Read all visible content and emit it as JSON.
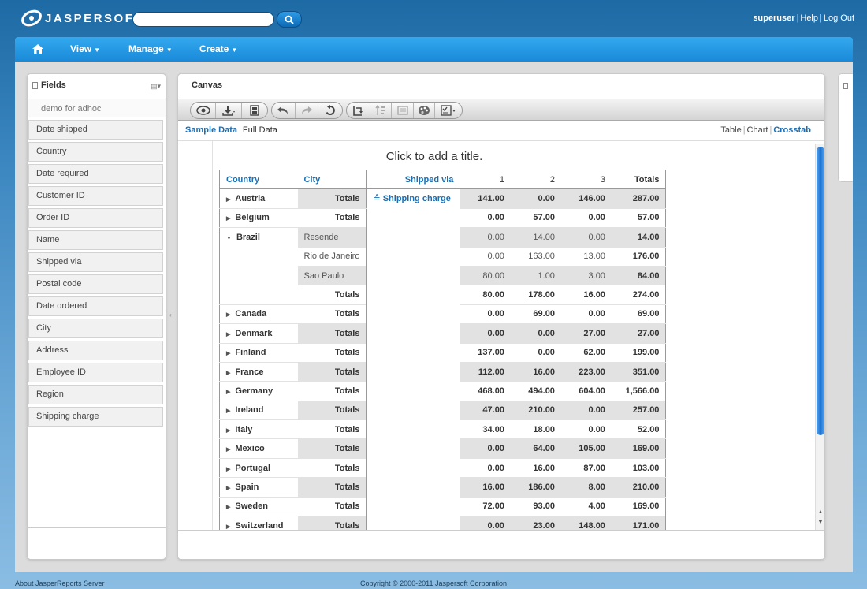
{
  "app": {
    "logo_text": "JASPERSOFT",
    "search_placeholder": ""
  },
  "user": {
    "username": "superuser",
    "help": "Help",
    "logout": "Log Out"
  },
  "nav": {
    "items": [
      {
        "label": "View"
      },
      {
        "label": "Manage"
      },
      {
        "label": "Create"
      }
    ]
  },
  "fields": {
    "title": "Fields",
    "source": "demo for adhoc",
    "items": [
      "Date shipped",
      "Country",
      "Date required",
      "Customer ID",
      "Order ID",
      "Name",
      "Shipped via",
      "Postal code",
      "Date ordered",
      "City",
      "Address",
      "Employee ID",
      "Region",
      "Shipping charge"
    ]
  },
  "canvas": {
    "title": "Canvas",
    "data_modes": {
      "sample": "Sample Data",
      "full": "Full Data"
    },
    "views": {
      "table": "Table",
      "chart": "Chart",
      "crosstab": "Crosstab"
    },
    "report_title": "Click to add a title."
  },
  "crosstab": {
    "headers": {
      "country": "Country",
      "city": "City",
      "shipped_via": "Shipped via",
      "c1": "1",
      "c2": "2",
      "c3": "3",
      "totals": "Totals"
    },
    "measure": "Shipping charge",
    "totals_label": "Totals",
    "rows": [
      {
        "country": "Austria",
        "v": [
          "141.00",
          "0.00",
          "146.00",
          "287.00"
        ]
      },
      {
        "country": "Belgium",
        "v": [
          "0.00",
          "57.00",
          "0.00",
          "57.00"
        ]
      },
      {
        "country": "Brazil",
        "expanded": true,
        "cities": [
          {
            "city": "Resende",
            "v": [
              "0.00",
              "14.00",
              "0.00",
              "14.00"
            ]
          },
          {
            "city": "Rio de Janeiro",
            "v": [
              "0.00",
              "163.00",
              "13.00",
              "176.00"
            ]
          },
          {
            "city": "Sao Paulo",
            "v": [
              "80.00",
              "1.00",
              "3.00",
              "84.00"
            ]
          }
        ],
        "v": [
          "80.00",
          "178.00",
          "16.00",
          "274.00"
        ]
      },
      {
        "country": "Canada",
        "v": [
          "0.00",
          "69.00",
          "0.00",
          "69.00"
        ]
      },
      {
        "country": "Denmark",
        "v": [
          "0.00",
          "0.00",
          "27.00",
          "27.00"
        ]
      },
      {
        "country": "Finland",
        "v": [
          "137.00",
          "0.00",
          "62.00",
          "199.00"
        ]
      },
      {
        "country": "France",
        "v": [
          "112.00",
          "16.00",
          "223.00",
          "351.00"
        ]
      },
      {
        "country": "Germany",
        "v": [
          "468.00",
          "494.00",
          "604.00",
          "1,566.00"
        ]
      },
      {
        "country": "Ireland",
        "v": [
          "47.00",
          "210.00",
          "0.00",
          "257.00"
        ]
      },
      {
        "country": "Italy",
        "v": [
          "34.00",
          "18.00",
          "0.00",
          "52.00"
        ]
      },
      {
        "country": "Mexico",
        "v": [
          "0.00",
          "64.00",
          "105.00",
          "169.00"
        ]
      },
      {
        "country": "Portugal",
        "v": [
          "0.00",
          "16.00",
          "87.00",
          "103.00"
        ]
      },
      {
        "country": "Spain",
        "v": [
          "16.00",
          "186.00",
          "8.00",
          "210.00"
        ]
      },
      {
        "country": "Sweden",
        "v": [
          "72.00",
          "93.00",
          "4.00",
          "169.00"
        ]
      },
      {
        "country": "Switzerland",
        "v": [
          "0.00",
          "23.00",
          "148.00",
          "171.00"
        ]
      }
    ]
  },
  "footer": {
    "about": "About JasperReports Server",
    "copyright": "Copyright © 2000-2011 Jaspersoft Corporation"
  },
  "colors": {
    "accent": "#1b6fb3",
    "nav": "#1a8ad8",
    "shade": "#e2e2e2"
  }
}
